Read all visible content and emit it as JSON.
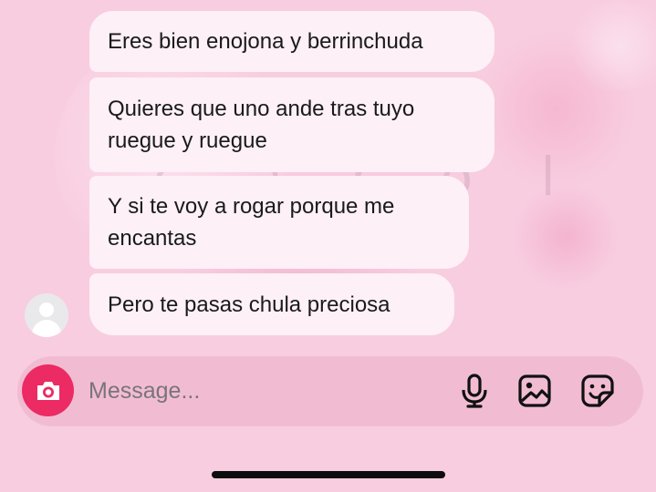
{
  "watermark": "c a r o l a",
  "messages": [
    {
      "text": "Eres bien enojona y berrinchuda"
    },
    {
      "line1": "Quieres que uno ande tras tuyo",
      "line2": "ruegue y ruegue"
    },
    {
      "line1": "Y si te voy a rogar porque me",
      "line2": "encantas"
    },
    {
      "text": "Pero te pasas chula preciosa"
    }
  ],
  "composer": {
    "placeholder": "Message...",
    "icons": [
      "camera-icon",
      "microphone-icon",
      "image-icon",
      "sticker-icon"
    ]
  },
  "colors": {
    "background": "#f8cde0",
    "bubble": "#fdf0f6",
    "composer": "#f1bcd2",
    "camera_button": "#ec2a64",
    "home_indicator": "#0e0e0e"
  }
}
